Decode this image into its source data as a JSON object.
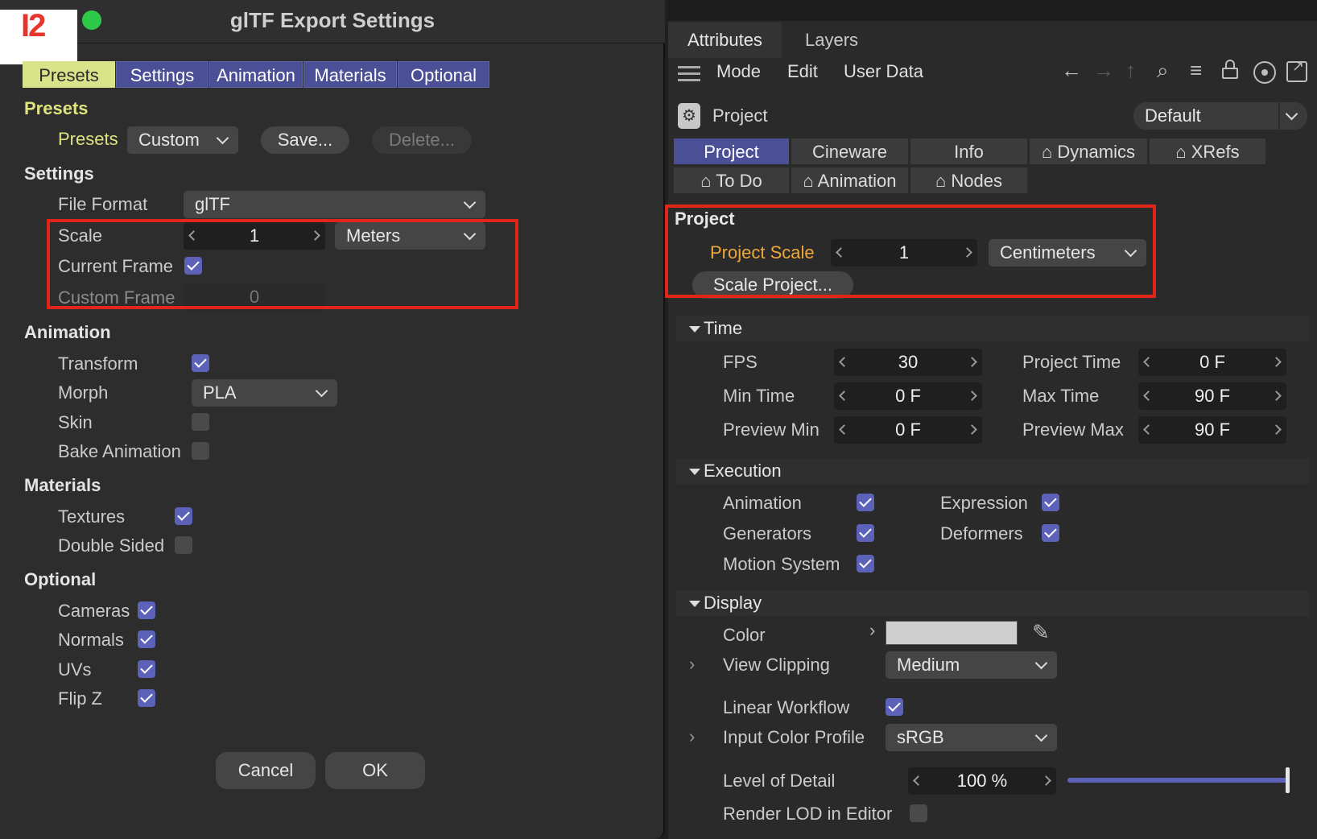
{
  "logo_text": "I2",
  "dialog": {
    "title": "glTF Export Settings",
    "tabs": [
      "Presets",
      "Settings",
      "Animation",
      "Materials",
      "Optional"
    ],
    "presets": {
      "section": "Presets",
      "label": "Presets",
      "value": "Custom",
      "save": "Save...",
      "delete": "Delete..."
    },
    "settings": {
      "section": "Settings",
      "file_format_label": "File Format",
      "file_format": "glTF",
      "scale_label": "Scale",
      "scale_value": "1",
      "scale_unit": "Meters",
      "current_frame_label": "Current Frame",
      "current_frame": true,
      "custom_frame_label": "Custom Frame",
      "custom_frame_value": "0"
    },
    "animation": {
      "section": "Animation",
      "transform_label": "Transform",
      "transform": true,
      "morph_label": "Morph",
      "morph_value": "PLA",
      "skin_label": "Skin",
      "skin": false,
      "bake_label": "Bake Animation",
      "bake": false
    },
    "materials": {
      "section": "Materials",
      "textures_label": "Textures",
      "textures": true,
      "double_sided_label": "Double Sided",
      "double_sided": false
    },
    "optional": {
      "section": "Optional",
      "cameras_label": "Cameras",
      "normals_label": "Normals",
      "uvs_label": "UVs",
      "flipz_label": "Flip Z",
      "cameras": true,
      "normals": true,
      "uvs": true,
      "flipz": true
    },
    "cancel": "Cancel",
    "ok": "OK"
  },
  "attributes": {
    "tabs": [
      "Attributes",
      "Layers"
    ],
    "menu": [
      "Mode",
      "Edit",
      "User Data"
    ],
    "object_label": "Project",
    "layout_preset": "Default",
    "ptabs_row1": [
      "Project",
      "Cineware",
      "Info",
      "Dynamics",
      "XRefs"
    ],
    "ptabs_row2": [
      "To Do",
      "Animation",
      "Nodes"
    ],
    "project": {
      "section": "Project",
      "scale_label": "Project Scale",
      "scale_value": "1",
      "scale_unit": "Centimeters",
      "scale_button": "Scale Project..."
    },
    "time": {
      "section": "Time",
      "fps_label": "FPS",
      "fps": "30",
      "project_time_label": "Project Time",
      "project_time": "0 F",
      "min_time_label": "Min Time",
      "min_time": "0 F",
      "max_time_label": "Max Time",
      "max_time": "90 F",
      "preview_min_label": "Preview Min",
      "preview_min": "0 F",
      "preview_max_label": "Preview Max",
      "preview_max": "90 F"
    },
    "execution": {
      "section": "Execution",
      "animation_label": "Animation",
      "expression_label": "Expression",
      "generators_label": "Generators",
      "deformers_label": "Deformers",
      "motion_label": "Motion System"
    },
    "display": {
      "section": "Display",
      "color_label": "Color",
      "color_value": "#cfcfcf",
      "clipping_label": "View Clipping",
      "clipping_value": "Medium",
      "linear_label": "Linear Workflow",
      "profile_label": "Input Color Profile",
      "profile_value": "sRGB",
      "lod_label": "Level of Detail",
      "lod_value": "100 %",
      "lod_fraction": 1.0,
      "render_lod_label": "Render LOD in Editor"
    }
  },
  "colors": {
    "accent": "#4a4f96",
    "highlight": "#e0261b",
    "active_tab": "#d9e48a",
    "orange_label": "#f0a83c"
  }
}
